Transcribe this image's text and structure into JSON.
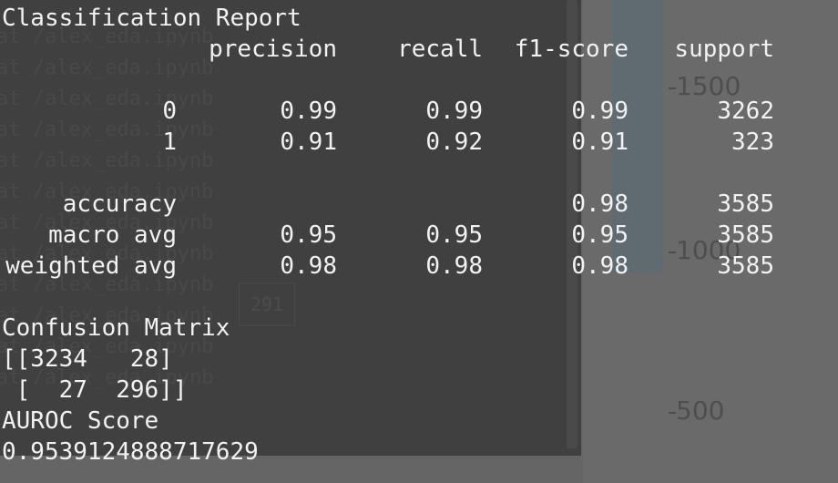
{
  "background": {
    "chart_ticks": [
      "1500",
      "1000",
      "500"
    ]
  },
  "ghost": {
    "line_text": "at /alex_eda.ipynb",
    "box_text": "291"
  },
  "report": {
    "title": "Classification Report",
    "headers": {
      "precision": "precision",
      "recall": "recall",
      "f1": "f1-score",
      "support": "support"
    },
    "rows": [
      {
        "label": "0",
        "precision": "0.99",
        "recall": "0.99",
        "f1": "0.99",
        "support": "3262"
      },
      {
        "label": "1",
        "precision": "0.91",
        "recall": "0.92",
        "f1": "0.91",
        "support": "323"
      },
      {
        "label": "accuracy",
        "precision": "",
        "recall": "",
        "f1": "0.98",
        "support": "3585"
      },
      {
        "label": "macro avg",
        "precision": "0.95",
        "recall": "0.95",
        "f1": "0.95",
        "support": "3585"
      },
      {
        "label": "weighted avg",
        "precision": "0.98",
        "recall": "0.98",
        "f1": "0.98",
        "support": "3585"
      }
    ]
  },
  "confusion": {
    "title": "Confusion Matrix",
    "line1": "[[3234   28]",
    "line2": " [  27  296]]"
  },
  "auroc": {
    "title": "AUROC Score",
    "value": "0.9539124888717629"
  },
  "colors": {
    "terminal_bg": "#404040",
    "text": "#f2f2f2",
    "backdrop": "#656565"
  }
}
